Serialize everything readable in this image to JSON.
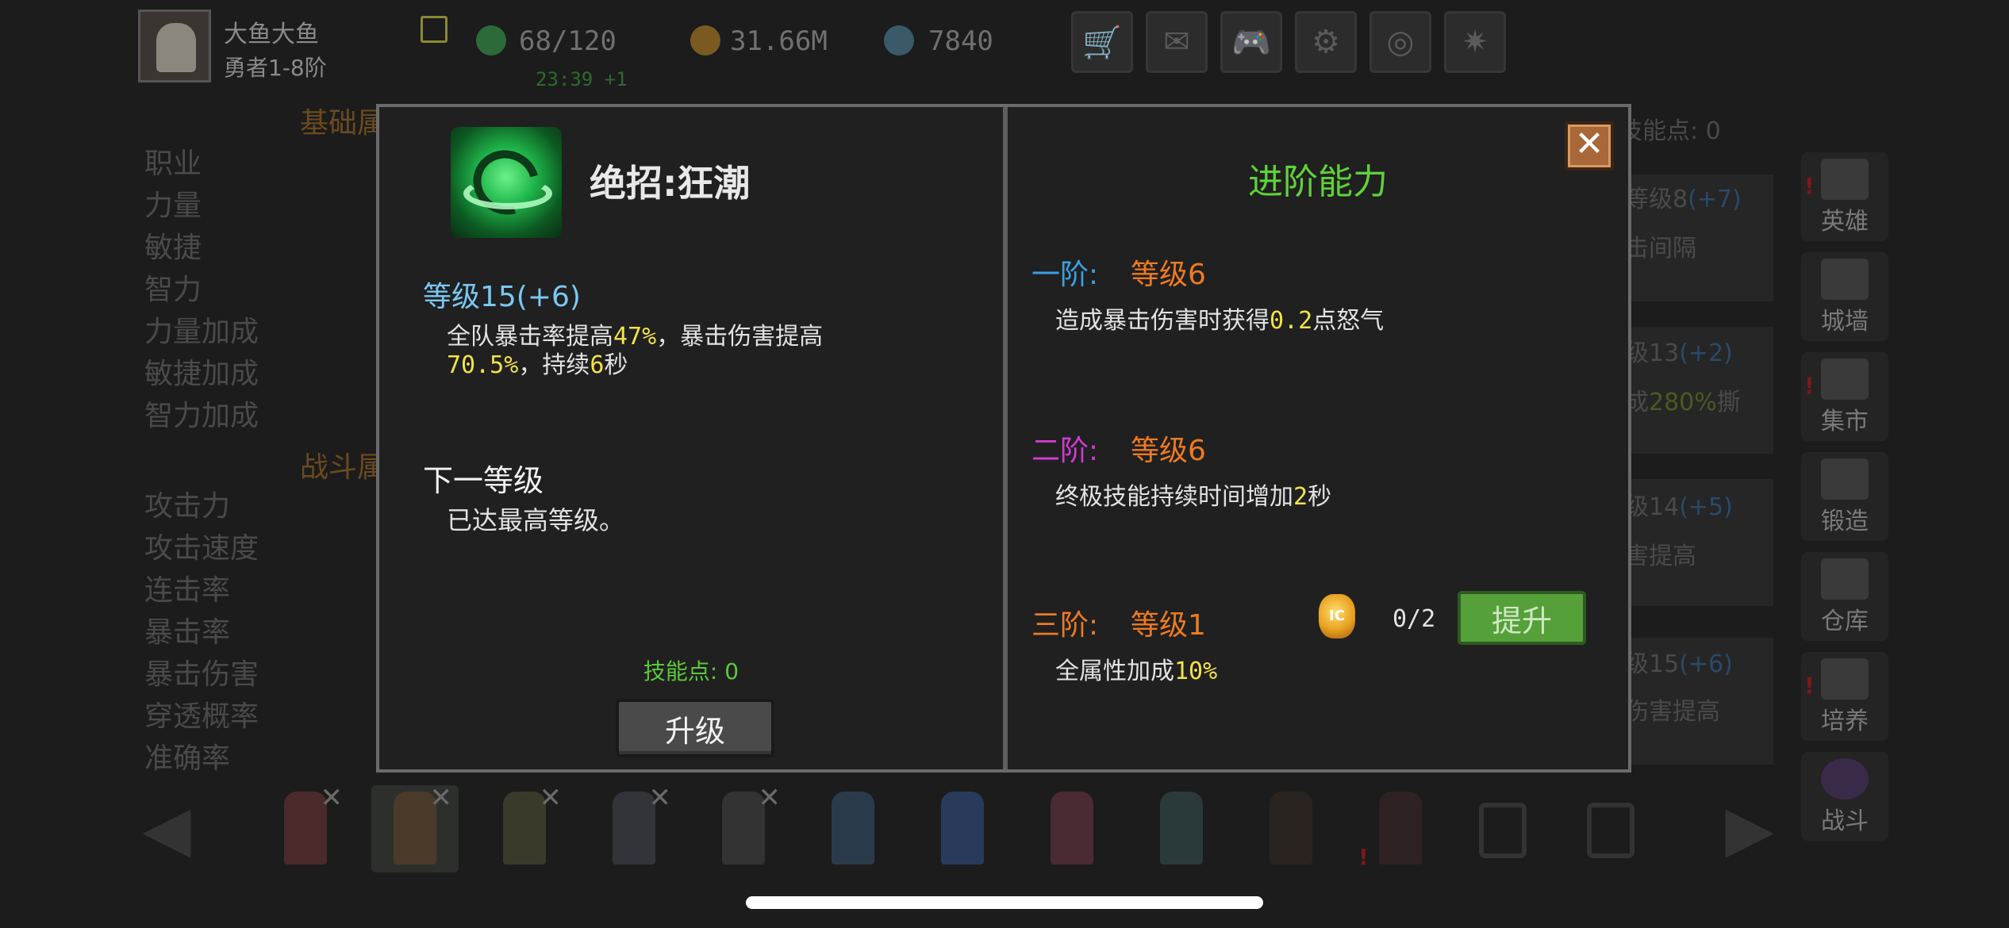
{
  "background": {
    "player": {
      "name": "大鱼大鱼",
      "rank": "勇者1-8阶"
    },
    "resources": {
      "energy": "68/120",
      "energy_timer": "23:39 +1",
      "gold": "31.66M",
      "gems": "7840"
    },
    "section_headings": [
      "基础属",
      "战斗属"
    ],
    "base_stats": [
      "职业",
      "力量",
      "敏捷",
      "智力",
      "力量加成",
      "敏捷加成",
      "智力加成"
    ],
    "battle_stats": [
      "攻击力",
      "攻击速度",
      "连击率",
      "暴击率",
      "暴击伤害",
      "穿透概率",
      "准确率"
    ],
    "skill_points_label": "技能点: 0",
    "skill_cards": [
      {
        "level": "等级8",
        "bonus": "(+7)",
        "desc": "击间隔"
      },
      {
        "level": "级13",
        "bonus": "(+2)",
        "desc_pre": "成",
        "desc_hl": "280%",
        "desc_post": "撕"
      },
      {
        "level": "级14",
        "bonus": "(+5)",
        "desc": "害提高"
      },
      {
        "level": "级15",
        "bonus": "(+6)",
        "desc": "伤害提高"
      }
    ],
    "side_menu": [
      "英雄",
      "城墙",
      "集市",
      "锻造",
      "仓库",
      "培养",
      "战斗"
    ]
  },
  "dialog": {
    "skill_name": "绝招:狂潮",
    "level": "等级15(+6)",
    "description": {
      "p1": "全队暴击率提高",
      "v1": "47%",
      "p2": "，暴击伤害提高",
      "v2": "70.5%",
      "p3": "，持续",
      "v3": "6",
      "p4": "秒"
    },
    "next_level_title": "下一等级",
    "next_level_desc": "已达最高等级。",
    "skill_points": "技能点: 0",
    "upgrade_button": "升级",
    "advanced": {
      "title": "进阶能力",
      "close_symbol": "✕",
      "tiers": [
        {
          "label": "一阶:",
          "level": "等级6",
          "desc_pre": "造成暴击伤害时获得",
          "desc_hl": "0.2",
          "desc_post": "点怒气"
        },
        {
          "label": "二阶:",
          "level": "等级6",
          "desc_pre": "终极技能持续时间增加",
          "desc_hl": "2",
          "desc_post": "秒"
        },
        {
          "label": "三阶:",
          "level": "等级1",
          "desc_pre": "全属性加成",
          "desc_hl": "10%",
          "desc_post": ""
        }
      ],
      "cost": "0/2",
      "coin_text": "IC",
      "promote_button": "提升"
    }
  },
  "colors": {
    "tier1": "#3aa0e2",
    "tier2": "#d23ad2",
    "tier3": "#ee7a22",
    "highlight": "#f2e34a",
    "accent_green": "#5fd23a"
  }
}
